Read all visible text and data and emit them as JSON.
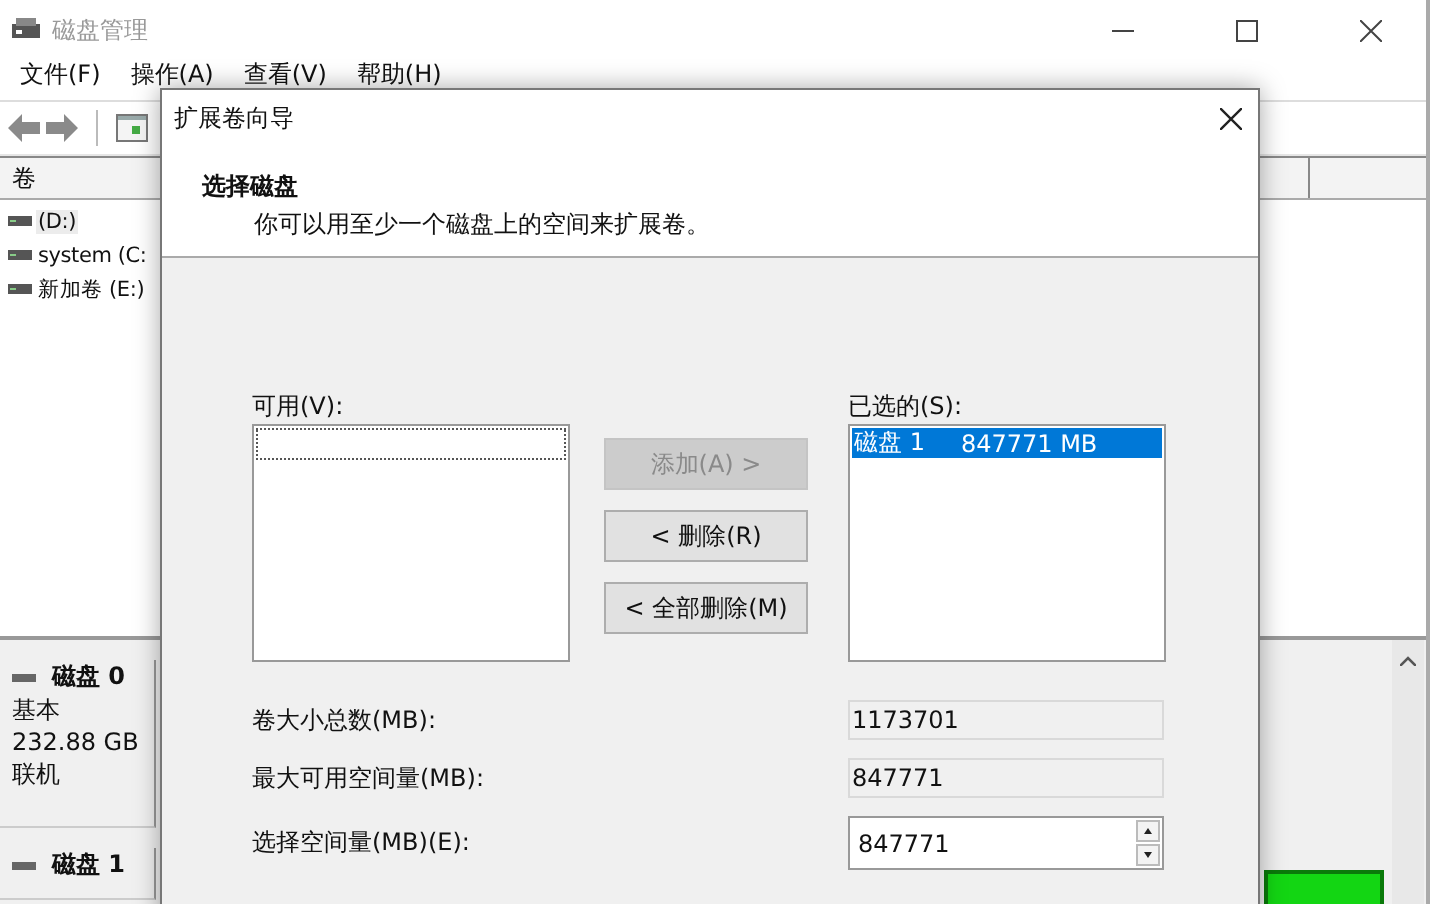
{
  "window": {
    "title": "磁盘管理"
  },
  "menu": [
    {
      "label": "文件(F)"
    },
    {
      "label": "操作(A)"
    },
    {
      "label": "查看(V)"
    },
    {
      "label": "帮助(H)"
    }
  ],
  "volume_list": {
    "column": "卷",
    "rows": [
      {
        "name": "(D:)",
        "selected": true
      },
      {
        "name": "system (C:",
        "selected": false
      },
      {
        "name": "新加卷 (E:)",
        "selected": false
      }
    ]
  },
  "disks": [
    {
      "name": "磁盘 0",
      "type": "基本",
      "size": "232.88 GB",
      "status": "联机"
    },
    {
      "name": "磁盘 1"
    }
  ],
  "dialog": {
    "title": "扩展卷向导",
    "heading": "选择磁盘",
    "description": "你可以用至少一个磁盘上的空间来扩展卷。",
    "available": {
      "label": "可用(V):"
    },
    "buttons": [
      {
        "label": "添加(A) >",
        "disabled": true
      },
      {
        "label": "< 删除(R)",
        "disabled": false
      },
      {
        "label": "< 全部删除(M)",
        "disabled": false
      }
    ],
    "chosen": {
      "label": "已选的(S):",
      "items": [
        {
          "disk": "磁盘 1",
          "size": "847771 MB",
          "selected": true
        }
      ]
    },
    "fields": [
      {
        "label": "卷大小总数(MB):",
        "value": "1173701",
        "kind": "readonly"
      },
      {
        "label": "最大可用空间量(MB):",
        "value": "847771",
        "kind": "readonly"
      },
      {
        "label": "选择空间量(MB)(E):",
        "value": "847771",
        "kind": "spinner"
      }
    ]
  }
}
